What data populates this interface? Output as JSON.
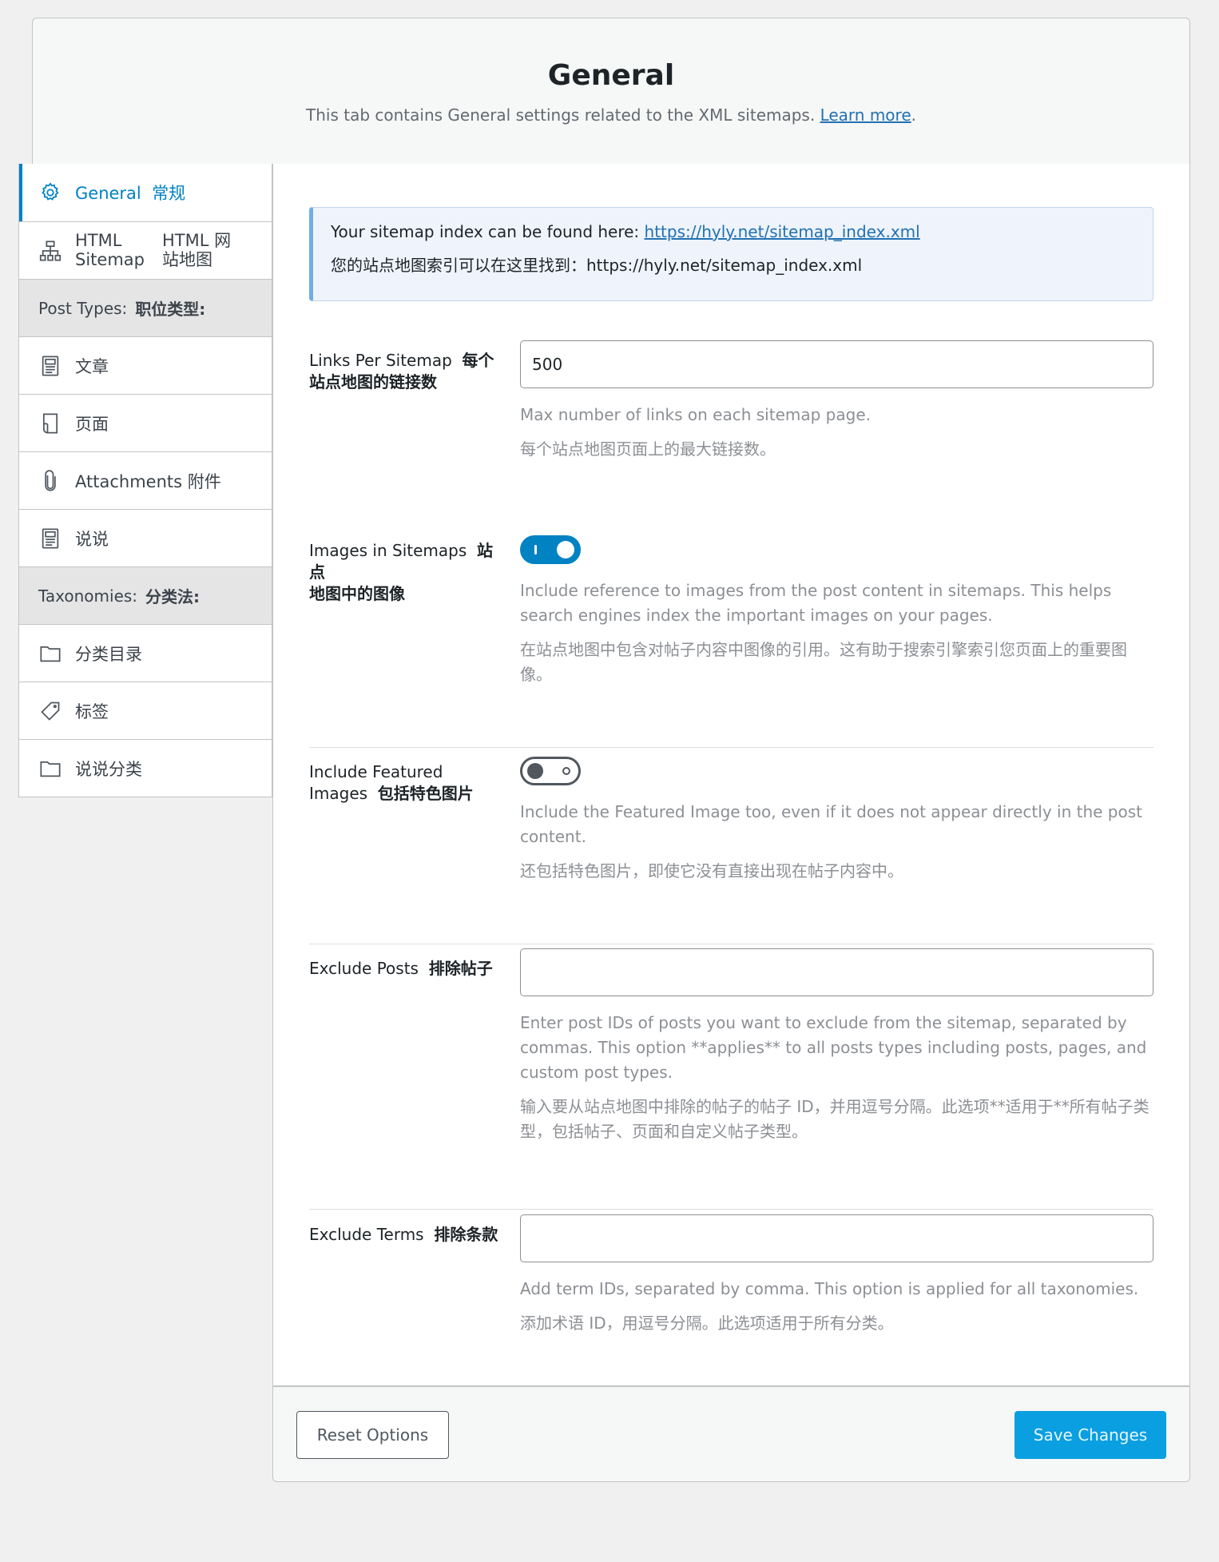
{
  "header": {
    "title": "General",
    "description": "This tab contains General settings related to the XML sitemaps.",
    "learn_more": "Learn more",
    "period": "."
  },
  "sidebar": {
    "general": {
      "en": "General",
      "cn": "常规",
      "icon": "gear-icon"
    },
    "html_sitemap": {
      "en1": "HTML",
      "en2": "Sitemap",
      "cn1": "HTML 网",
      "cn2": "站地图",
      "icon": "sitemap-icon"
    },
    "post_types_heading": {
      "en": "Post Types:",
      "cn": "职位类型:"
    },
    "post_types": [
      {
        "label": "文章",
        "icon": "post-icon"
      },
      {
        "label": "页面",
        "icon": "page-icon"
      },
      {
        "label": "Attachments  附件",
        "icon": "paperclip-icon"
      },
      {
        "label": "说说",
        "icon": "post-icon"
      }
    ],
    "taxonomies_heading": {
      "en": "Taxonomies:",
      "cn": "分类法:"
    },
    "taxonomies": [
      {
        "label": "分类目录",
        "icon": "folder-icon"
      },
      {
        "label": "标签",
        "icon": "tag-icon"
      },
      {
        "label": "说说分类",
        "icon": "folder-icon"
      }
    ]
  },
  "notice": {
    "line1_prefix": "Your sitemap index can be found here: ",
    "line1_link": "https://hyly.net/sitemap_index.xml",
    "line2": "您的站点地图索引可以在这里找到：https://hyly.net/sitemap_index.xml"
  },
  "settings": {
    "links_per_sitemap": {
      "label_en": "Links Per Sitemap",
      "label_cn1": "每个",
      "label_cn2": "站点地图的链接数",
      "value": "500",
      "help_en": "Max number of links on each sitemap page.",
      "help_cn": "每个站点地图页面上的最大链接数。"
    },
    "images_in_sitemaps": {
      "label_en": "Images in Sitemaps",
      "label_cn1": "站点",
      "label_cn2": "地图中的图像",
      "enabled": true,
      "help_en": "Include reference to images from the post content in sitemaps. This helps search engines index the important images on your pages.",
      "help_cn": "在站点地图中包含对帖子内容中图像的引用。这有助于搜索引擎索引您页面上的重要图像。"
    },
    "include_featured_images": {
      "label_en1": "Include Featured",
      "label_en2": "Images",
      "label_cn": "包括特色图片",
      "enabled": false,
      "help_en": "Include the Featured Image too, even if it does not appear directly in the post content.",
      "help_cn": "还包括特色图片，即使它没有直接出现在帖子内容中。"
    },
    "exclude_posts": {
      "label_en": "Exclude Posts",
      "label_cn": "排除帖子",
      "value": "",
      "help_en": "Enter post IDs of posts you want to exclude from the sitemap, separated by commas. This option **applies** to all posts types including posts, pages, and custom post types.",
      "help_cn": "输入要从站点地图中排除的帖子的帖子 ID，并用逗号分隔。此选项**适用于**所有帖子类型，包括帖子、页面和自定义帖子类型。"
    },
    "exclude_terms": {
      "label_en": "Exclude Terms",
      "label_cn": "排除条款",
      "value": "",
      "help_en": "Add term IDs, separated by comma. This option is applied for all taxonomies.",
      "help_cn": "添加术语 ID，用逗号分隔。此选项适用于所有分类。"
    }
  },
  "footer": {
    "reset_label": "Reset Options",
    "save_label": "Save Changes"
  },
  "colors": {
    "accent": "#0082c3",
    "save_button": "#0a9fe0",
    "notice_bg": "#eef3fc",
    "notice_border": "#72aee6"
  }
}
